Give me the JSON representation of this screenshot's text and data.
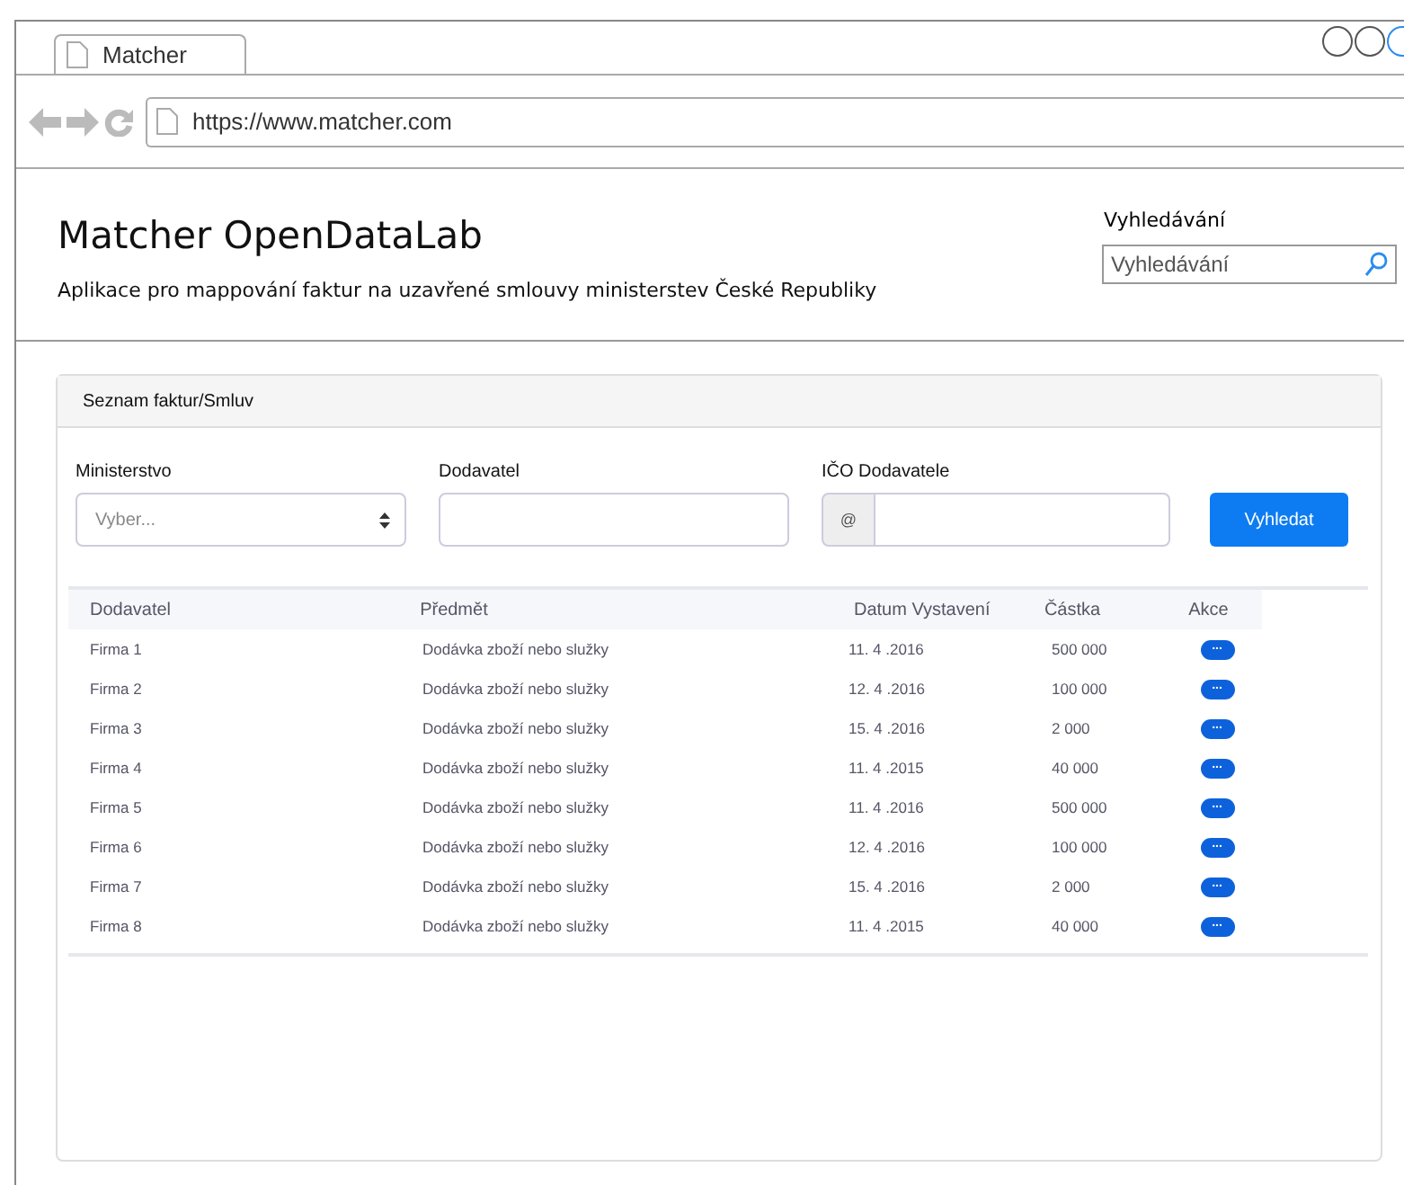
{
  "browser": {
    "tab_title": "Matcher",
    "url": "https://www.matcher.com"
  },
  "header": {
    "title": "Matcher OpenDataLab",
    "subtitle": "Aplikace pro mappování faktur na uzavřené smlouvy ministerstev České Republiky",
    "search_label": "Vyhledávání",
    "search_placeholder": "Vyhledávání"
  },
  "panel": {
    "title": "Seznam faktur/Smluv",
    "filters": [
      {
        "kind": "select",
        "label": "Ministerstvo",
        "placeholder": "Vyber..."
      },
      {
        "kind": "text",
        "label": "Dodavatel"
      },
      {
        "kind": "addon",
        "label": "IČO Dodavatele",
        "addon": "@"
      }
    ],
    "search_button": "Vyhledat",
    "table": {
      "columns": [
        "Dodavatel",
        "Předmět",
        "Datum Vystavení",
        "Částka",
        "Akce"
      ],
      "rows": [
        {
          "supplier": "Firma 1",
          "subject": "Dodávka zboží nebo služky",
          "date": "11. 4 .2016",
          "amount": "500 000",
          "action": "..."
        },
        {
          "supplier": "Firma 2",
          "subject": "Dodávka zboží nebo služky",
          "date": "12. 4 .2016",
          "amount": "100 000",
          "action": "..."
        },
        {
          "supplier": "Firma 3",
          "subject": "Dodávka zboží nebo služky",
          "date": "15. 4 .2016",
          "amount": "2 000",
          "action": "..."
        },
        {
          "supplier": "Firma 4",
          "subject": "Dodávka zboží nebo služky",
          "date": "11. 4 .2015",
          "amount": "40 000",
          "action": "..."
        },
        {
          "supplier": "Firma 5",
          "subject": "Dodávka zboží nebo služky",
          "date": "11. 4 .2016",
          "amount": "500 000",
          "action": "..."
        },
        {
          "supplier": "Firma 6",
          "subject": "Dodávka zboží nebo služky",
          "date": "12. 4 .2016",
          "amount": "100 000",
          "action": "..."
        },
        {
          "supplier": "Firma 7",
          "subject": "Dodávka zboží nebo služky",
          "date": "15. 4 .2016",
          "amount": "2 000",
          "action": "..."
        },
        {
          "supplier": "Firma 8",
          "subject": "Dodávka zboží nebo služky",
          "date": "11. 4 .2015",
          "amount": "40 000",
          "action": "..."
        }
      ]
    }
  }
}
